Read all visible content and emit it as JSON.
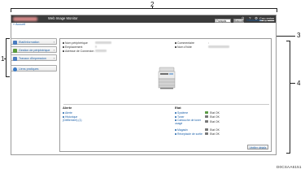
{
  "callouts": [
    "1",
    "2",
    "3",
    "4"
  ],
  "header": {
    "app_title": "Web Image Monitor",
    "right_link": "Connexion",
    "icons": [
      "search-icon",
      "help-icon",
      "settings-icon"
    ]
  },
  "subbar": {
    "back_link": "« Accueil"
  },
  "toolbar": {
    "language": "Français",
    "language_go": "Basculer",
    "refresh": "Actualiser",
    "help_symbol": "?"
  },
  "sidebar": {
    "items": [
      {
        "label": "Etat/Information",
        "arrow": "›",
        "icon_color": "#4a7cc0",
        "icon": "info-icon"
      },
      {
        "label": "Gestion de périphérique",
        "arrow": "›",
        "icon_color": "#5a9b3c",
        "icon": "device-management-icon"
      },
      {
        "label": "Travaux d'impression",
        "arrow": "›",
        "icon_color": "#4a7cc0",
        "icon": "print-job-icon"
      },
      {
        "label": "Liens pratiques",
        "arrow": "",
        "icon_color": "#3a7bc8",
        "icon": "link-icon"
      }
    ]
  },
  "device_info": {
    "fields_left": [
      "Nom périphérique",
      "Emplacement",
      "Adresse de Connexion"
    ],
    "fields_right": [
      "Commentaire",
      "Nom d'hôte"
    ],
    "comment_value": ":"
  },
  "alerts": {
    "title": "Alerte",
    "items": [
      "Alerte",
      "Historique (Défilement) (1)"
    ]
  },
  "status": {
    "title": "Etat",
    "items": [
      {
        "label": "Système",
        "value": "Etat OK"
      },
      {
        "label": "Toner",
        "value": "Etat OK"
      },
      {
        "label": "Cartouche de toner usagé",
        "value": "Etat OK"
      },
      {
        "label": "Magasin",
        "value": "Etat OK"
      },
      {
        "label": "Réceptacle de sortie",
        "value": "Etat OK"
      }
    ],
    "details_button": "Vérifier détails"
  },
  "figure_code": "D0CSAA6151"
}
